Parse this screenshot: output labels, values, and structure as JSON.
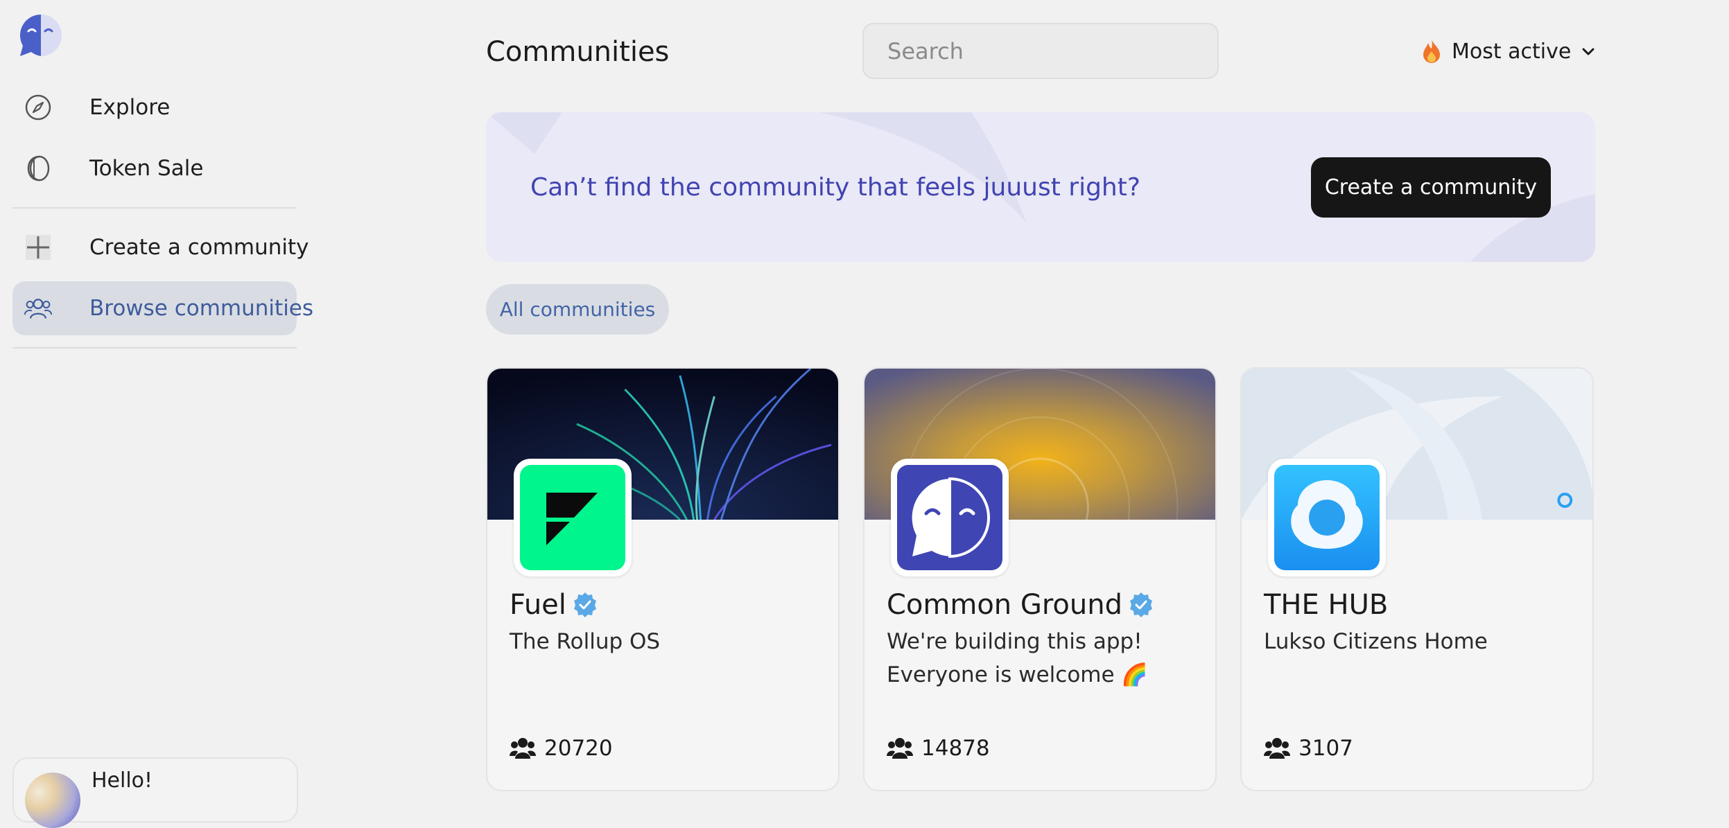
{
  "sidebar": {
    "logo_icon": "common-ground-logo-icon",
    "items": [
      {
        "label": "Explore",
        "icon": "compass-icon"
      },
      {
        "label": "Token Sale",
        "icon": "coin-icon"
      },
      {
        "label": "Create a community",
        "icon": "plus-icon"
      },
      {
        "label": "Browse communities",
        "icon": "people-icon",
        "active": true
      }
    ],
    "user": {
      "greeting": "Hello!"
    }
  },
  "header": {
    "title": "Communities",
    "search_placeholder": "Search",
    "sort_label": "Most active",
    "sort_icon": "fire-icon"
  },
  "banner": {
    "text": "Can’t find the community that feels juuust right?",
    "button_label": "Create a community"
  },
  "filter": {
    "label": "All communities"
  },
  "communities": [
    {
      "name": "Fuel",
      "verified": true,
      "description": "The Rollup OS",
      "members": "20720"
    },
    {
      "name": "Common Ground",
      "verified": true,
      "description": "We're building this app! Everyone is welcome 🌈",
      "members": "14878"
    },
    {
      "name": "THE HUB",
      "verified": false,
      "description": "Lukso Citizens Home",
      "members": "3107"
    }
  ],
  "colors": {
    "accent": "#4143b0",
    "active_nav_bg": "#d9dde3",
    "active_nav_text": "#3f5b9c",
    "button_dark": "#161616",
    "verified_badge": "#5aa9e6"
  }
}
